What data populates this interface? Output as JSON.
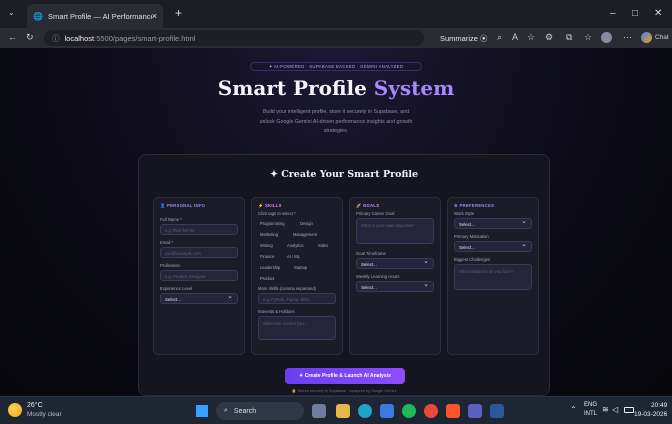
{
  "browser": {
    "tab_title": "Smart Profile — AI Performance A",
    "tab_close": "×",
    "new_tab": "+",
    "url_host": "localhost",
    "url_path": ":5500/pages/smart-profile.html",
    "summarize": "Summarize",
    "chat": "Chat",
    "win_min": "–",
    "win_max": "□",
    "win_close": "✕"
  },
  "hero": {
    "badge": "✦ AI-POWERED · SUPABASE BACKED · GEMINI ANALYZED",
    "title_a": "Smart Profile ",
    "title_b": "System",
    "subtitle": "Build your intelligent profile, store it securely in Supabase, and unlock Google Gemini AI-driven performance insights and growth strategies."
  },
  "form": {
    "title": "✦ Create Your Smart Profile",
    "personal": {
      "heading": "👤 PERSONAL INFO",
      "name_label": "Full Name *",
      "name_ph": "e.g. Ravi Mehta",
      "email_label": "Email *",
      "email_ph": "you@example.com",
      "profession_label": "Profession",
      "profession_ph": "e.g. Product Designer",
      "exp_label": "Experience Level",
      "exp_value": "Select..."
    },
    "skills": {
      "heading": "⚡ SKILLS",
      "chips_label": "Click tags to select *",
      "chips": [
        "Programming",
        "Design",
        "Marketing",
        "Management",
        "Writing",
        "Analytics",
        "Sales",
        "Finance",
        "AI / ML",
        "Leadership",
        "Startup",
        "Product"
      ],
      "more_label": "More Skills (comma separated)",
      "more_ph": "e.g. Python, Figma, SEO",
      "interests_label": "Interests & Hobbies",
      "interests_ph": "What else excites you..."
    },
    "goals": {
      "heading": "🚀 GOALS",
      "career_label": "Primary Career Goal",
      "career_ph": "What is your main objective?",
      "timeframe_label": "Goal Timeframe",
      "timeframe_value": "Select...",
      "hours_label": "Weekly Learning Hours",
      "hours_value": "Select..."
    },
    "prefs": {
      "heading": "⚙ PREFERENCES",
      "style_label": "Work Style",
      "style_value": "Select...",
      "motivation_label": "Primary Motivation",
      "motivation_value": "Select...",
      "challenges_label": "Biggest Challenges",
      "challenges_ph": "What obstacles do you face?"
    },
    "cta": "✦ Create Profile & Launch AI Analysis",
    "footnote": "🔒 Stored securely in Supabase · Analyzed by Google Gemini"
  },
  "taskbar": {
    "temp": "26°C",
    "weather": "Mostly clear",
    "search": "Search",
    "lang1": "ENG",
    "lang2": "INTL",
    "time": "20:49",
    "date": "19-03-2026"
  },
  "colors": {
    "accent": "#8b5cf6",
    "bg": "#08080f"
  }
}
